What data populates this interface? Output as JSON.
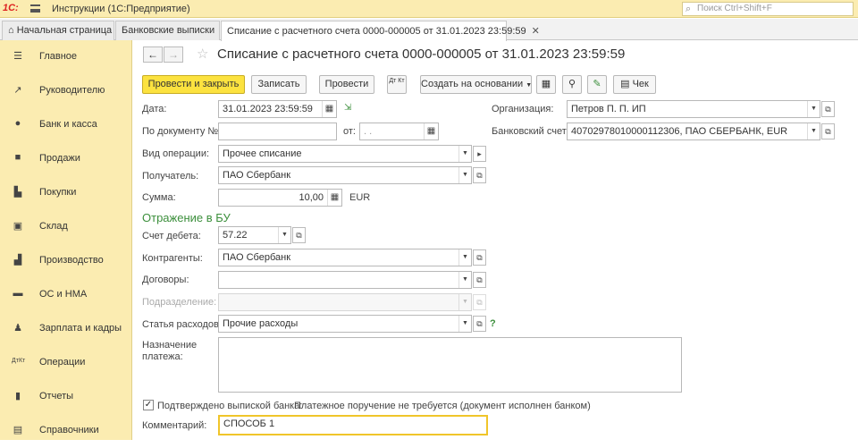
{
  "app": {
    "logo": "1С:",
    "title": "Инструкции (1С:Предприятие)",
    "search_placeholder": "Поиск Ctrl+Shift+F"
  },
  "tabs": {
    "home": "Начальная страница",
    "bank": "Банковские выписки",
    "doc": "Списание с расчетного счета 0000-000005 от 31.01.2023 23:59:59"
  },
  "sidebar": {
    "items": [
      {
        "label": "Главное",
        "icon": "menu-icon"
      },
      {
        "label": "Руководителю",
        "icon": "chart-icon"
      },
      {
        "label": "Банк и касса",
        "icon": "coin-icon"
      },
      {
        "label": "Продажи",
        "icon": "bag-icon"
      },
      {
        "label": "Покупки",
        "icon": "cart-icon"
      },
      {
        "label": "Склад",
        "icon": "warehouse-icon"
      },
      {
        "label": "Производство",
        "icon": "factory-icon"
      },
      {
        "label": "ОС и НМА",
        "icon": "truck-icon"
      },
      {
        "label": "Зарплата и кадры",
        "icon": "person-icon"
      },
      {
        "label": "Операции",
        "icon": "dt-kt-icon"
      },
      {
        "label": "Отчеты",
        "icon": "bars-icon"
      },
      {
        "label": "Справочники",
        "icon": "book-icon"
      }
    ]
  },
  "header": {
    "title": "Списание с расчетного счета 0000-000005 от 31.01.2023 23:59:59"
  },
  "toolbar": {
    "post_close": "Провести и закрыть",
    "save": "Записать",
    "post": "Провести",
    "dtkt": "Дт Кт",
    "create_based": "Создать на основании",
    "check": "Чек"
  },
  "form": {
    "date_label": "Дата:",
    "date_value": "31.01.2023 23:59:59",
    "org_label": "Организация:",
    "org_value": "Петров П. П. ИП",
    "docnum_label": "По документу №:",
    "docnum_value": "",
    "from_label": "от:",
    "from_value": ". .",
    "bank_label": "Банковский счет:",
    "bank_value": "40702978010000112306, ПАО СБЕРБАНК, EUR",
    "optype_label": "Вид операции:",
    "optype_value": "Прочее списание",
    "recipient_label": "Получатель:",
    "recipient_value": "ПАО Сбербанк",
    "sum_label": "Сумма:",
    "sum_value": "10,00",
    "currency": "EUR",
    "section_title": "Отражение в БУ",
    "debit_label": "Счет дебета:",
    "debit_value": "57.22",
    "contractors_label": "Контрагенты:",
    "contractors_value": "ПАО Сбербанк",
    "contracts_label": "Договоры:",
    "contracts_value": "",
    "division_label": "Подразделение:",
    "division_value": "",
    "expense_label": "Статья расходов:",
    "expense_value": "Прочие расходы",
    "help": "?",
    "purpose_label": "Назначение платежа:",
    "purpose_value": "",
    "confirmed_label": "Подтверждено выпиской банка:",
    "confirmed_checked": true,
    "note": "Платежное поручение не требуется (документ исполнен банком)",
    "comment_label": "Комментарий:",
    "comment_value": "СПОСОБ 1"
  },
  "colors": {
    "accent": "#fce23f",
    "sidebar": "#fbecb1",
    "section": "#3c8f3c"
  }
}
